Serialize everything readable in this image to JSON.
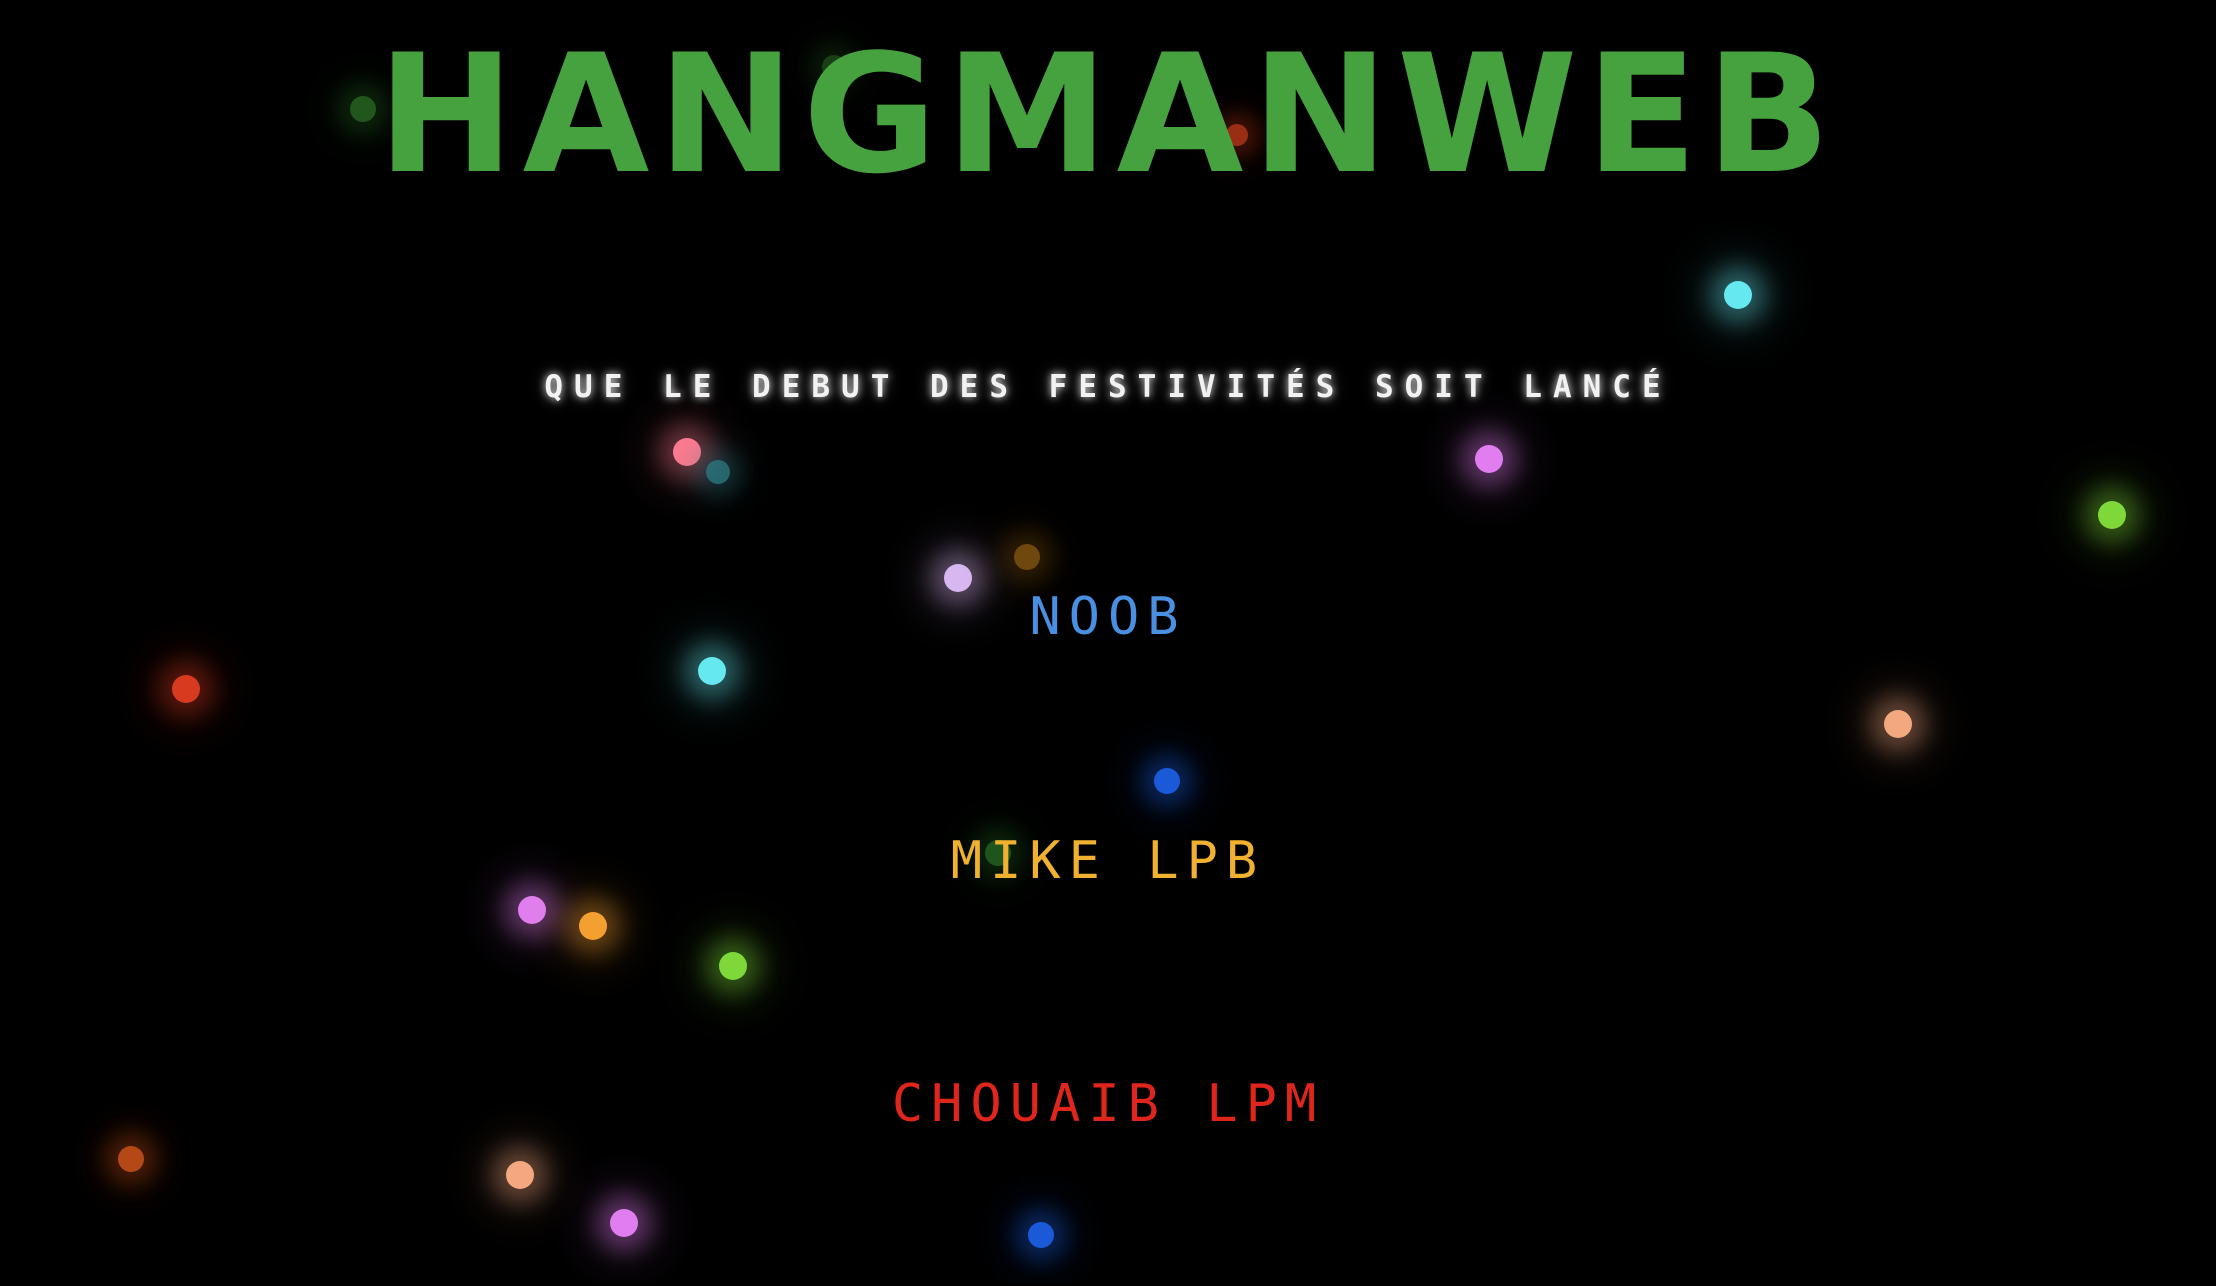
{
  "game": {
    "title": "HANGMANWEB",
    "tagline": "QUE LE DEBUT DES FESTIVITÉS SOIT LANCÉ"
  },
  "levels": [
    {
      "label": "NOOB",
      "color": "#4a90e2"
    },
    {
      "label": "MIKE LPB",
      "color": "#f0b030"
    },
    {
      "label": "CHOUAIB LPM",
      "color": "#e0261c"
    }
  ],
  "colors": {
    "background": "#000000",
    "title": "#46a23f",
    "tagline": "#f2f2f2"
  }
}
